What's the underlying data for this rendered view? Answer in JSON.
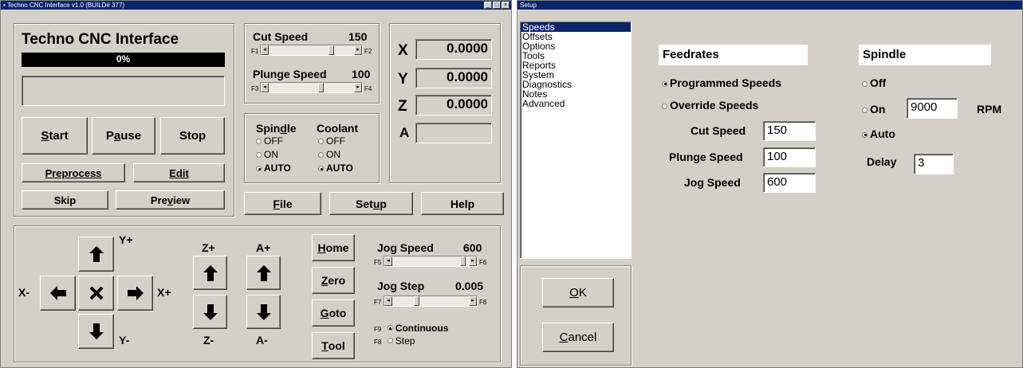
{
  "left_window": {
    "title": "Techno CNC Interface v1.0  (BUILD# 377)",
    "app_title": "Techno CNC Interface",
    "progress_percent": 0,
    "progress_label": "0%",
    "buttons": {
      "start": {
        "pre": "",
        "u": "S",
        "post": "tart"
      },
      "pause": {
        "pre": "P",
        "u": "a",
        "post": "use"
      },
      "stop": {
        "pre": "Stop",
        "u": "",
        "post": ""
      },
      "preprocess": {
        "pre": "",
        "u": "P",
        "post": "reprocess"
      },
      "edit": {
        "pre": "",
        "u": "E",
        "post": "dit"
      },
      "skip": {
        "pre": "Skip",
        "u": "",
        "post": ""
      },
      "preview": {
        "pre": "Pre",
        "u": "v",
        "post": "iew"
      },
      "file": {
        "pre": "",
        "u": "F",
        "post": "ile"
      },
      "setup": {
        "pre": "Set",
        "u": "u",
        "post": "p"
      },
      "help": {
        "pre": "Help",
        "u": "",
        "post": ""
      },
      "home": {
        "pre": "",
        "u": "H",
        "post": "ome"
      },
      "zero": {
        "pre": "",
        "u": "Z",
        "post": "ero"
      },
      "goto": {
        "pre": "",
        "u": "G",
        "post": "oto"
      },
      "tool": {
        "pre": "",
        "u": "T",
        "post": "ool"
      }
    },
    "cut_speed": {
      "label": "Cut Speed",
      "value": "150",
      "key_left": "F1",
      "key_right": "F2",
      "level": 0.75
    },
    "plunge_speed": {
      "label": "Plunge Speed",
      "value": "100",
      "key_left": "F3",
      "key_right": "F4",
      "level": 0.62
    },
    "spindle": {
      "title_pre": "Spin",
      "title_u": "d",
      "title_post": "le",
      "options": [
        "OFF",
        "ON",
        "AUTO"
      ],
      "selected": "AUTO"
    },
    "coolant": {
      "title": "Coolant",
      "options": [
        "OFF",
        "ON",
        "AUTO"
      ],
      "selected": "AUTO"
    },
    "axes": [
      {
        "name": "X",
        "value": "0.0000"
      },
      {
        "name": "Y",
        "value": "0.0000"
      },
      {
        "name": "Z",
        "value": "0.0000"
      },
      {
        "name": "A",
        "value": ""
      }
    ],
    "jog_labels": {
      "y_plus": "Y+",
      "y_minus": "Y-",
      "x_minus": "X-",
      "x_plus": "X+",
      "z_plus": "Z+",
      "z_minus": "Z-",
      "a_plus": "A+",
      "a_minus": "A-"
    },
    "jog_speed": {
      "label": "Jog Speed",
      "value": "600",
      "key_left": "F5",
      "key_right": "F6",
      "level": 0.96
    },
    "jog_step": {
      "label": "Jog Step",
      "value": "0.005",
      "key_left": "F7",
      "key_right": "F8",
      "level": 0.3
    },
    "jog_mode": {
      "continuous_key": "F9",
      "continuous": "Continuous",
      "step_key": "F8",
      "step": "Step",
      "selected": "Continuous"
    }
  },
  "right_window": {
    "title": "Setup",
    "list_items": [
      "Speeds",
      "Offsets",
      "Options",
      "Tools",
      "Reports",
      "System",
      "Diagnostics",
      "Notes",
      "Advanced"
    ],
    "selected_item": "Speeds",
    "ok": {
      "pre": "",
      "u": "O",
      "post": "K"
    },
    "cancel": {
      "pre": "",
      "u": "C",
      "post": "ancel"
    },
    "feedrates": {
      "header": "Feedrates",
      "programmed": "Programmed Speeds",
      "override": "Override Speeds",
      "selected": "Programmed Speeds",
      "cut_label": "Cut Speed",
      "cut_value": "150",
      "plunge_label": "Plunge Speed",
      "plunge_value": "100",
      "jog_label": "Jog Speed",
      "jog_value": "600"
    },
    "spindle": {
      "header": "Spindle",
      "off": "Off",
      "on": "On",
      "auto": "Auto",
      "selected": "Auto",
      "rpm_value": "9000",
      "rpm_unit": "RPM",
      "delay_label": "Delay",
      "delay_value": "3"
    }
  },
  "colors": {
    "title_bar": "#0a246a",
    "face": "#d4d0c8",
    "progress_bg": "#000000"
  }
}
